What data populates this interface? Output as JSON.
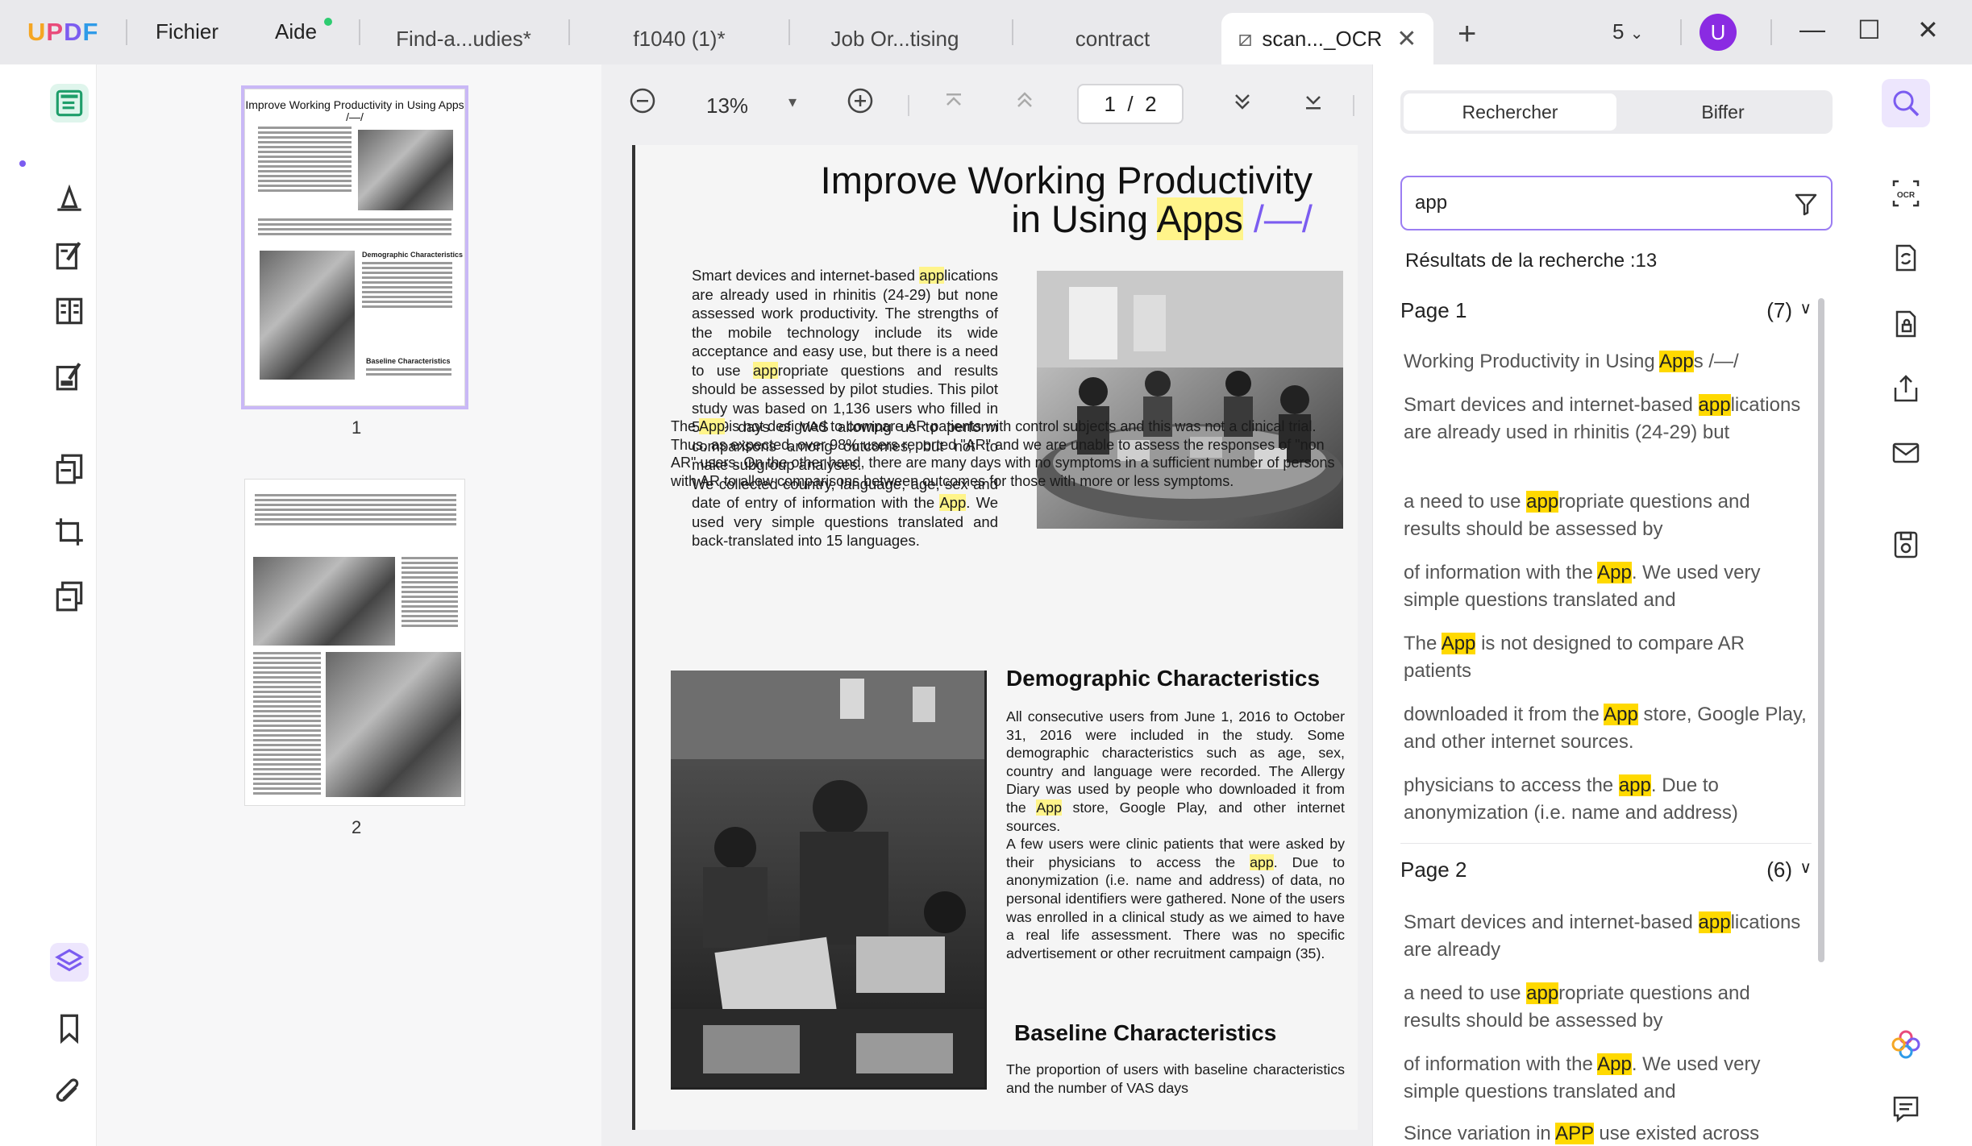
{
  "app": {
    "logo": "UPDF",
    "menu": {
      "file": "Fichier",
      "help": "Aide"
    }
  },
  "tabs": [
    {
      "label": "Find-a...udies*"
    },
    {
      "label": "f1040 (1)*"
    },
    {
      "label": "Job Or...tising"
    },
    {
      "label": "contract"
    },
    {
      "label": "scan..._OCR",
      "active": true
    }
  ],
  "titlebar": {
    "tab_count": "5",
    "avatar_letter": "U"
  },
  "thumbnails": [
    {
      "label": "1",
      "title": "Improve Working Productivity in Using Apps /—/",
      "headings": [
        "Demographic Characteristics",
        "Baseline Characteristics"
      ]
    },
    {
      "label": "2"
    }
  ],
  "toolbar": {
    "zoom": "13%",
    "page_current": "1",
    "page_sep": "/",
    "page_total": "2"
  },
  "document": {
    "title_line1": "Improve Working Productivity",
    "title_line2_pre": "in Using ",
    "title_line2_hl": "Apps",
    "title_line2_post": " /—/",
    "p1_a": "Smart devices and internet-based ",
    "p1_hl1": "app",
    "p1_b": "lications are already used in rhinitis (24-29) but none assessed work productivity. The strengths of the mobile technology include its wide acceptance and easy use, but there is a need to use ",
    "p1_hl2": "app",
    "p1_c": "ropriate questions and results should be assessed by pilot studies. This pilot study was based on 1,136 users who filled in 5,789 days of VAS allowing us to perform comparisons among outcomes, but not to make subgroup analyses.",
    "p2_a": "We collected country, language, age, sex and date of entry of information with the ",
    "p2_hl": "App",
    "p2_b": ". We used very simple questions translated and back-translated into 15 languages.",
    "p3_a": "The ",
    "p3_hl": "App",
    "p3_b": " is not designed to compare AR patients with control subjects and this was not a clinical trial. Thus, as expected, over 98% users reported \"AR\" and we are unable to assess the responses of \"non AR\" users. On the other hand, there are many days with no symptoms in a sufficient number of persons with AR to allow comparisons between outcomes for those with more or less symptoms.",
    "h_demo": "Demographic Characteristics",
    "p4_a": "All consecutive users from June 1, 2016 to October 31, 2016 were included in the study. Some demographic characteristics such as age, sex, country and language were recorded. The Allergy Diary was used by people who downloaded it from the ",
    "p4_hl": "App",
    "p4_b": " store, Google Play, and other internet sources.",
    "p5_a": "A few users were clinic patients that were asked by their physicians to access the ",
    "p5_hl": "app",
    "p5_b": ". Due to anonymization (i.e. name and address) of data, no personal identifiers were gathered. None of the users was enrolled in a clinical study as we aimed to have a real life assessment. There was no specific advertisement or other  recruitment campaign (35).",
    "h_base": "Baseline Characteristics",
    "p6": "The proportion of users with baseline characteristics and the number of VAS days"
  },
  "search": {
    "tab_search": "Rechercher",
    "tab_strike": "Biffer",
    "query": "app",
    "results_label": "Résultats de la recherche :13",
    "groups": [
      {
        "title": "Page 1",
        "count": "(7)"
      },
      {
        "title": "Page 2",
        "count": "(6)"
      }
    ],
    "results": [
      {
        "pre": "Working Productivity in Using ",
        "hl": "App",
        "post": "s /—/"
      },
      {
        "pre": "Smart devices and internet-based ",
        "hl": "app",
        "post": "lications are already used in rhinitis (24-29) but"
      },
      {
        "pre": "a need to use ",
        "hl": "app",
        "post": "ropriate questions and results should be assessed by"
      },
      {
        "pre": "of information with the ",
        "hl": "App",
        "post": ". We used very simple questions translated and"
      },
      {
        "pre": "The ",
        "hl": "App",
        "post": " is not designed to compare AR patients"
      },
      {
        "pre": "downloaded it from the ",
        "hl": "App",
        "post": " store, Google Play, and other internet sources."
      },
      {
        "pre": "physicians to access the ",
        "hl": "app",
        "post": ". Due to anonymization (i.e. name and address)"
      },
      {
        "pre": "Smart devices and internet-based ",
        "hl": "app",
        "post": "lications are already"
      },
      {
        "pre": "a need to use ",
        "hl": "app",
        "post": "ropriate questions and results should be assessed by"
      },
      {
        "pre": "of information with the ",
        "hl": "App",
        "post": ". We used very simple questions translated and"
      },
      {
        "pre": "Since variation in ",
        "hl": "APP",
        "post": " use existed across"
      }
    ]
  },
  "icons": {
    "left_rail": [
      "reader-icon",
      "comment-icon",
      "edit-icon",
      "page-organize-icon",
      "form-icon",
      "convert-icon",
      "crop-icon",
      "compress-icon",
      "layers-icon",
      "bookmark-icon",
      "attachment-icon"
    ],
    "right_rail": [
      "search-icon",
      "ocr-icon",
      "convert-icon",
      "protect-icon",
      "share-icon",
      "email-icon",
      "save-icon",
      "ai-icon",
      "chat-icon"
    ]
  },
  "colors": {
    "accent": "#7b5cf0",
    "highlight": "#ffd900",
    "active_rail": "#dff5ec"
  }
}
